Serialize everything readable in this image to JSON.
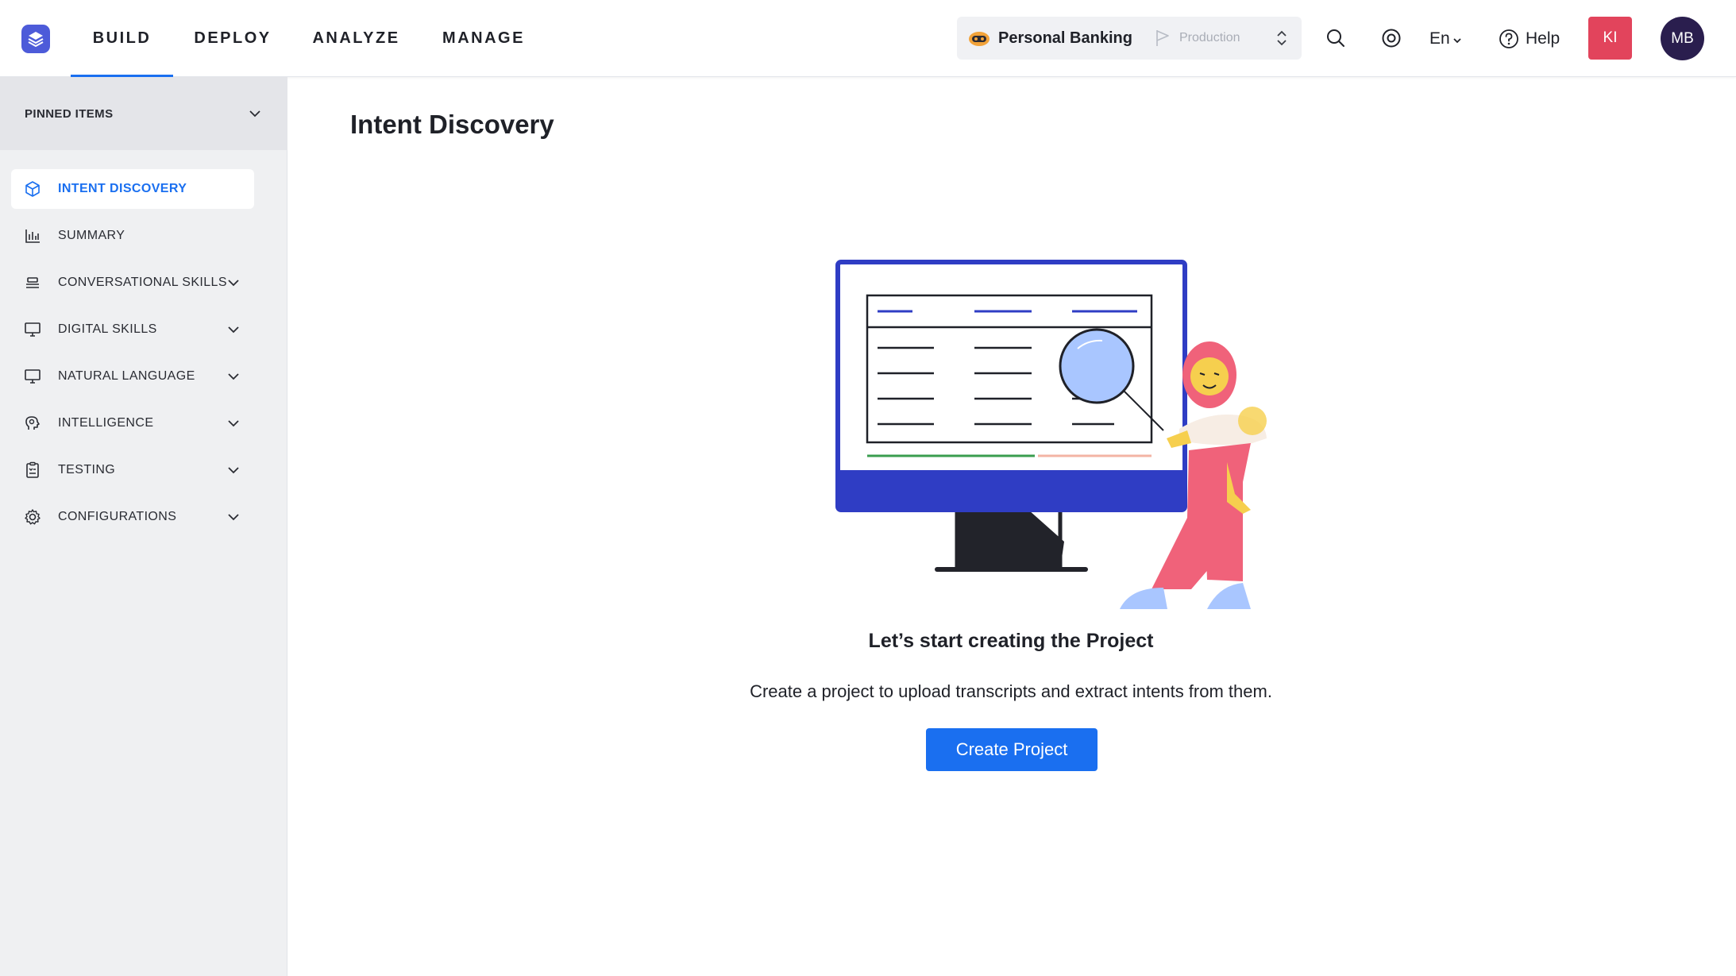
{
  "topnav": {
    "tabs": [
      {
        "label": "BUILD",
        "active": true
      },
      {
        "label": "DEPLOY",
        "active": false
      },
      {
        "label": "ANALYZE",
        "active": false
      },
      {
        "label": "MANAGE",
        "active": false
      }
    ]
  },
  "bot_selector": {
    "bot_name": "Personal Banking",
    "environment": "Production"
  },
  "header_actions": {
    "language": "En",
    "help_label": "Help",
    "workspace_initials": "KI",
    "user_initials": "MB",
    "workspace_color": "#e2445c",
    "user_color": "#2a1e4e"
  },
  "sidebar": {
    "pinned_label": "PINNED ITEMS",
    "items": [
      {
        "label": "INTENT DISCOVERY",
        "icon": "cube-icon",
        "active": true,
        "expandable": false
      },
      {
        "label": "SUMMARY",
        "icon": "bar-chart-icon",
        "active": false,
        "expandable": false
      },
      {
        "label": "CONVERSATIONAL SKILLS",
        "icon": "stack-icon",
        "active": false,
        "expandable": true
      },
      {
        "label": "DIGITAL SKILLS",
        "icon": "monitor-icon",
        "active": false,
        "expandable": true
      },
      {
        "label": "NATURAL LANGUAGE",
        "icon": "monitor-icon",
        "active": false,
        "expandable": true
      },
      {
        "label": "INTELLIGENCE",
        "icon": "brain-icon",
        "active": false,
        "expandable": true
      },
      {
        "label": "TESTING",
        "icon": "clipboard-icon",
        "active": false,
        "expandable": true
      },
      {
        "label": "CONFIGURATIONS",
        "icon": "gear-icon",
        "active": false,
        "expandable": true
      }
    ]
  },
  "main": {
    "title": "Intent Discovery",
    "empty_state": {
      "heading": "Let’s start creating the Project",
      "description": "Create a project to upload transcripts and extract intents from them.",
      "button_label": "Create Project"
    }
  },
  "colors": {
    "accent": "#1a6ff0",
    "sidebar_bg": "#eff0f2"
  }
}
